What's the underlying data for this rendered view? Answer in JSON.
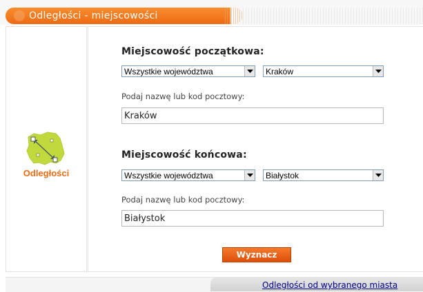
{
  "header": {
    "title": "Odległości - miejscowości"
  },
  "logo": {
    "label": "Odległości",
    "icon": "poland-map-distance-icon"
  },
  "start": {
    "title": "Miejscowość początkowa:",
    "voivodeship_select": {
      "value": "Wszystkie województwa"
    },
    "city_select": {
      "value": "Kraków"
    },
    "input_label": "Podaj nazwę lub kod pocztowy:",
    "input_value": "Kraków"
  },
  "end": {
    "title": "Miejscowość końcowa:",
    "voivodeship_select": {
      "value": "Wszystkie województwa"
    },
    "city_select": {
      "value": "Białystok"
    },
    "input_label": "Podaj nazwę lub kod pocztowy:",
    "input_value": "Białystok"
  },
  "submit_label": "Wyznacz",
  "footer": {
    "link": "Odległości od wybranego miasta"
  },
  "colors": {
    "accent": "#ee6b12",
    "map_green": "#c2d93e",
    "link": "#000080"
  }
}
